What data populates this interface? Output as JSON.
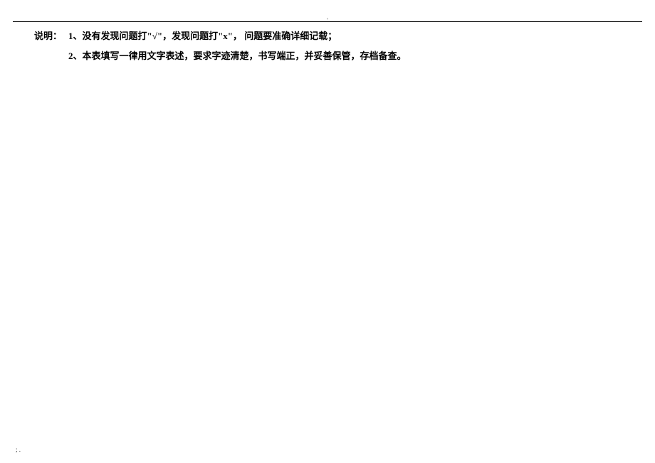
{
  "topMark": "'",
  "instructions": {
    "label": "说明：",
    "item1": "1、没有发现问题打\"√\"，发现问题打\"x\"， 问题要准确详细记载；",
    "item2": "2、本表填写一律用文字表述，要求字迹清楚，书写端正，并妥善保管，存档备查。"
  },
  "bottomMark": "; ."
}
